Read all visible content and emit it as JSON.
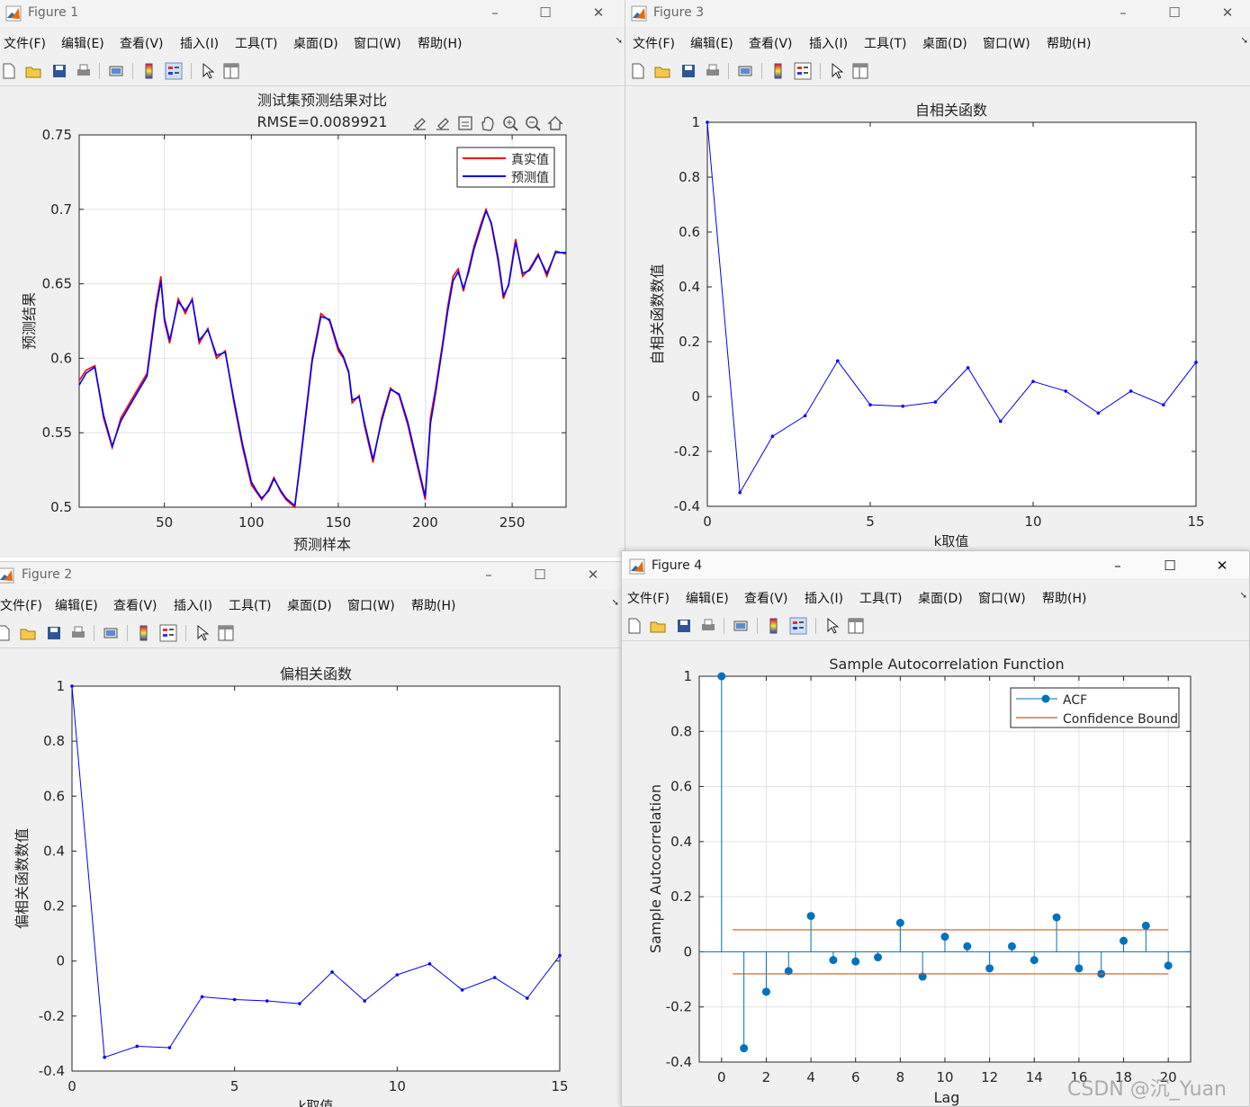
{
  "watermark": "CSDN @沉_Yuan",
  "windows": {
    "fig1": {
      "title": "Figure 1",
      "menu": [
        "文件(F)",
        "编辑(E)",
        "查看(V)",
        "插入(I)",
        "工具(T)",
        "桌面(D)",
        "窗口(W)",
        "帮助(H)"
      ],
      "plot": {
        "title": "测试集预测结果对比",
        "subtitle": "RMSE=0.0089921",
        "xlabel": "预测样本",
        "ylabel": "预测结果",
        "xticks": [
          "50",
          "100",
          "150",
          "200",
          "250"
        ],
        "yticks": [
          "0.5",
          "0.55",
          "0.6",
          "0.65",
          "0.7",
          "0.75"
        ],
        "legend": [
          "真实值",
          "预测值"
        ]
      }
    },
    "fig2": {
      "title": "Figure 2",
      "menu": [
        "文件(F)",
        "编辑(E)",
        "查看(V)",
        "插入(I)",
        "工具(T)",
        "桌面(D)",
        "窗口(W)",
        "帮助(H)"
      ],
      "plot": {
        "title": "偏相关函数",
        "xlabel": "k取值",
        "ylabel": "偏相关函数数值",
        "xticks": [
          "0",
          "5",
          "10",
          "15"
        ],
        "yticks": [
          "-0.4",
          "-0.2",
          "0",
          "0.2",
          "0.4",
          "0.6",
          "0.8",
          "1"
        ]
      }
    },
    "fig3": {
      "title": "Figure 3",
      "menu": [
        "文件(F)",
        "编辑(E)",
        "查看(V)",
        "插入(I)",
        "工具(T)",
        "桌面(D)",
        "窗口(W)",
        "帮助(H)"
      ],
      "plot": {
        "title": "自相关函数",
        "xlabel": "k取值",
        "ylabel": "自相关函数数值",
        "xticks": [
          "0",
          "5",
          "10",
          "15"
        ],
        "yticks": [
          "-0.4",
          "-0.2",
          "0",
          "0.2",
          "0.4",
          "0.6",
          "0.8",
          "1"
        ]
      }
    },
    "fig4": {
      "title": "Figure 4",
      "menu": [
        "文件(F)",
        "编辑(E)",
        "查看(V)",
        "插入(I)",
        "工具(T)",
        "桌面(D)",
        "窗口(W)",
        "帮助(H)"
      ],
      "plot": {
        "title": "Sample Autocorrelation Function",
        "xlabel": "Lag",
        "ylabel": "Sample Autocorrelation",
        "xticks": [
          "0",
          "2",
          "4",
          "6",
          "8",
          "10",
          "12",
          "14",
          "16",
          "18",
          "20"
        ],
        "yticks": [
          "-0.4",
          "-0.2",
          "0",
          "0.2",
          "0.4",
          "0.6",
          "0.8",
          "1"
        ],
        "legend": [
          "ACF",
          "Confidence Bound"
        ]
      }
    }
  },
  "chart_data": [
    {
      "id": "fig1",
      "type": "line",
      "title": "测试集预测结果对比",
      "subtitle": "RMSE=0.0089921",
      "xlabel": "预测样本",
      "ylabel": "预测结果",
      "xlim": [
        1,
        281
      ],
      "ylim": [
        0.5,
        0.75
      ],
      "grid": true,
      "legend_position": "top-right",
      "colors": [
        "#ff0000",
        "#0000ff"
      ],
      "series": [
        {
          "name": "真实值",
          "x": [
            1,
            5,
            10,
            15,
            20,
            25,
            30,
            35,
            40,
            45,
            48,
            50,
            53,
            58,
            62,
            66,
            70,
            75,
            80,
            85,
            90,
            95,
            100,
            103,
            106,
            110,
            113,
            117,
            120,
            125,
            128,
            132,
            135,
            140,
            145,
            150,
            153,
            156,
            158,
            162,
            165,
            170,
            175,
            180,
            185,
            190,
            195,
            200,
            203,
            206,
            210,
            213,
            216,
            219,
            222,
            225,
            228,
            232,
            235,
            238,
            242,
            245,
            248,
            252,
            256,
            260,
            265,
            270,
            275,
            281
          ],
          "y": [
            0.585,
            0.592,
            0.595,
            0.56,
            0.54,
            0.56,
            0.57,
            0.58,
            0.59,
            0.635,
            0.655,
            0.625,
            0.61,
            0.64,
            0.63,
            0.64,
            0.61,
            0.62,
            0.6,
            0.605,
            0.57,
            0.54,
            0.515,
            0.51,
            0.505,
            0.512,
            0.52,
            0.51,
            0.505,
            0.5,
            0.53,
            0.57,
            0.6,
            0.63,
            0.625,
            0.605,
            0.6,
            0.59,
            0.57,
            0.575,
            0.555,
            0.53,
            0.56,
            0.58,
            0.575,
            0.555,
            0.53,
            0.505,
            0.56,
            0.58,
            0.61,
            0.635,
            0.655,
            0.66,
            0.645,
            0.66,
            0.675,
            0.69,
            0.7,
            0.69,
            0.665,
            0.64,
            0.65,
            0.68,
            0.655,
            0.66,
            0.67,
            0.655,
            0.672,
            0.67
          ]
        },
        {
          "name": "预测值",
          "x": [
            1,
            5,
            10,
            15,
            20,
            25,
            30,
            35,
            40,
            45,
            48,
            50,
            53,
            58,
            62,
            66,
            70,
            75,
            80,
            85,
            90,
            95,
            100,
            103,
            106,
            110,
            113,
            117,
            120,
            125,
            128,
            132,
            135,
            140,
            145,
            150,
            153,
            156,
            158,
            162,
            165,
            170,
            175,
            180,
            185,
            190,
            195,
            200,
            203,
            206,
            210,
            213,
            216,
            219,
            222,
            225,
            228,
            232,
            235,
            238,
            242,
            245,
            248,
            252,
            256,
            260,
            265,
            270,
            275,
            281
          ],
          "y": [
            0.582,
            0.59,
            0.594,
            0.562,
            0.541,
            0.558,
            0.568,
            0.578,
            0.588,
            0.632,
            0.652,
            0.627,
            0.612,
            0.638,
            0.632,
            0.639,
            0.612,
            0.619,
            0.602,
            0.604,
            0.572,
            0.542,
            0.517,
            0.511,
            0.506,
            0.511,
            0.519,
            0.511,
            0.506,
            0.501,
            0.528,
            0.568,
            0.598,
            0.628,
            0.626,
            0.607,
            0.601,
            0.591,
            0.572,
            0.574,
            0.557,
            0.532,
            0.558,
            0.579,
            0.576,
            0.557,
            0.532,
            0.507,
            0.556,
            0.577,
            0.608,
            0.632,
            0.652,
            0.658,
            0.647,
            0.658,
            0.673,
            0.688,
            0.699,
            0.691,
            0.667,
            0.642,
            0.649,
            0.678,
            0.657,
            0.659,
            0.669,
            0.657,
            0.671,
            0.671
          ]
        }
      ]
    },
    {
      "id": "fig2",
      "type": "line",
      "title": "偏相关函数",
      "xlabel": "k取值",
      "ylabel": "偏相关函数数值",
      "xlim": [
        0,
        15
      ],
      "ylim": [
        -0.4,
        1
      ],
      "grid": false,
      "colors": [
        "#0000ff"
      ],
      "series": [
        {
          "x": [
            0,
            1,
            2,
            3,
            4,
            5,
            6,
            7,
            8,
            9,
            10,
            11,
            12,
            13,
            14,
            15
          ],
          "y": [
            1,
            -0.35,
            -0.31,
            -0.315,
            -0.13,
            -0.14,
            -0.145,
            -0.155,
            -0.04,
            -0.145,
            -0.05,
            -0.01,
            -0.105,
            -0.06,
            -0.135,
            0.02
          ]
        }
      ]
    },
    {
      "id": "fig3",
      "type": "line",
      "title": "自相关函数",
      "xlabel": "k取值",
      "ylabel": "自相关函数数值",
      "xlim": [
        0,
        15
      ],
      "ylim": [
        -0.4,
        1
      ],
      "grid": false,
      "colors": [
        "#0000ff"
      ],
      "series": [
        {
          "x": [
            0,
            1,
            2,
            3,
            4,
            5,
            6,
            7,
            8,
            9,
            10,
            11,
            12,
            13,
            14,
            15
          ],
          "y": [
            1,
            -0.35,
            -0.145,
            -0.07,
            0.13,
            -0.03,
            -0.035,
            -0.02,
            0.105,
            -0.09,
            0.055,
            0.02,
            -0.06,
            0.02,
            -0.03,
            0.125
          ]
        }
      ]
    },
    {
      "id": "fig4",
      "type": "scatter",
      "title": "Sample Autocorrelation Function",
      "xlabel": "Lag",
      "ylabel": "Sample Autocorrelation",
      "xlim": [
        -1,
        21
      ],
      "ylim": [
        -0.4,
        1
      ],
      "grid": true,
      "legend_position": "top-right",
      "colors": [
        "#0072bd",
        "#d95319"
      ],
      "series": [
        {
          "name": "ACF",
          "x": [
            0,
            1,
            2,
            3,
            4,
            5,
            6,
            7,
            8,
            9,
            10,
            11,
            12,
            13,
            14,
            15,
            16,
            17,
            18,
            19,
            20
          ],
          "y": [
            1,
            -0.35,
            -0.145,
            -0.07,
            0.13,
            -0.03,
            -0.035,
            -0.02,
            0.105,
            -0.09,
            0.055,
            0.02,
            -0.06,
            0.02,
            -0.03,
            0.125,
            -0.06,
            -0.08,
            0.04,
            0.095,
            -0.05
          ]
        },
        {
          "name": "Confidence Bound",
          "x": [
            0.5,
            20
          ],
          "y": [
            0.08,
            0.08
          ],
          "y_lower": [
            -0.08,
            -0.08
          ]
        }
      ]
    }
  ]
}
